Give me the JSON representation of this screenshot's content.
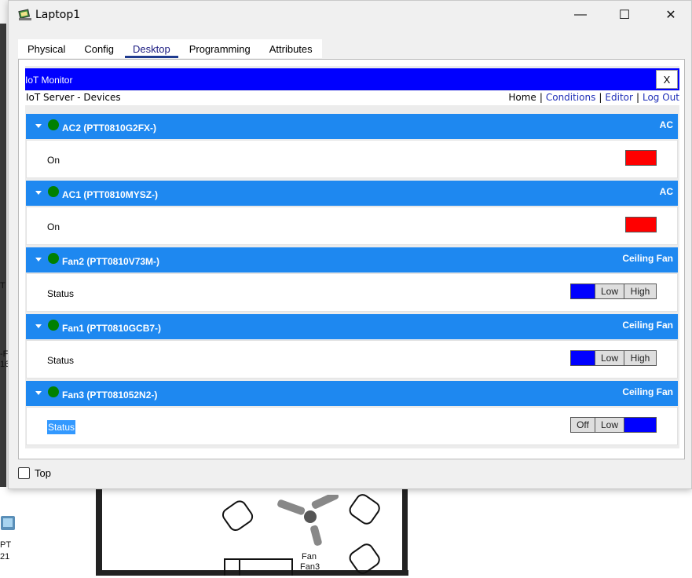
{
  "window": {
    "title": "Laptop1",
    "controls": {
      "minimize": "—",
      "maximize": "☐",
      "close": "✕"
    }
  },
  "tabs": [
    {
      "label": "Physical",
      "active": false
    },
    {
      "label": "Config",
      "active": false
    },
    {
      "label": "Desktop",
      "active": true
    },
    {
      "label": "Programming",
      "active": false
    },
    {
      "label": "Attributes",
      "active": false
    }
  ],
  "iot_monitor": {
    "title": "IoT Monitor",
    "close_label": "X",
    "server_title": "IoT Server - Devices",
    "nav": {
      "home": "Home",
      "conditions": "Conditions",
      "editor": "Editor",
      "logout": "Log Out",
      "separator": "|"
    }
  },
  "devices": [
    {
      "name": "AC2 (PTT0810G2FX-)",
      "type": "AC",
      "property": "On",
      "control": "toggle",
      "status_color": "#008000"
    },
    {
      "name": "AC1 (PTT0810MYSZ-)",
      "type": "AC",
      "property": "On",
      "control": "toggle",
      "status_color": "#008000"
    },
    {
      "name": "Fan2 (PTT0810V73M-)",
      "type": "Ceiling Fan",
      "property": "Status",
      "control": "fan",
      "options": [
        "Off",
        "Low",
        "High"
      ],
      "selected": "Off"
    },
    {
      "name": "Fan1 (PTT0810GCB7-)",
      "type": "Ceiling Fan",
      "property": "Status",
      "control": "fan",
      "options": [
        "Off",
        "Low",
        "High"
      ],
      "selected": "Off"
    },
    {
      "name": "Fan3 (PTT081052N2-)",
      "type": "Ceiling Fan",
      "property": "Status",
      "control": "fan",
      "options": [
        "Off",
        "Low",
        "High"
      ],
      "selected": "High"
    }
  ],
  "top_checkbox": {
    "label": "Top",
    "checked": false
  },
  "background": {
    "labels": {
      "pt_a": "PT",
      "pt_b": "21",
      "fan_a": "Fan",
      "fan_b": "Fan3",
      "edge_t": "T",
      "edge_f": "-F",
      "edge_16": "16"
    }
  },
  "colors": {
    "iot_bar": "#0000ff",
    "device_header": "#1e88f0",
    "status_ok": "#008000",
    "toggle_off": "#ff0000"
  }
}
